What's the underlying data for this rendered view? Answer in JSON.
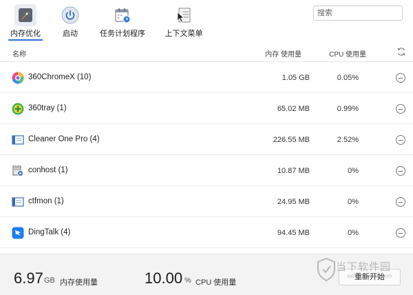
{
  "toolbar": {
    "tabs": [
      {
        "label": "内存优化",
        "icon": "rocket-icon",
        "active": true
      },
      {
        "label": "启动",
        "icon": "power-icon",
        "active": false
      },
      {
        "label": "任务计划程序",
        "icon": "calendar-clock-icon",
        "active": false
      },
      {
        "label": "上下文菜单",
        "icon": "cursor-menu-icon",
        "active": false
      }
    ],
    "search_placeholder": "搜索"
  },
  "table": {
    "headers": {
      "name": "名称",
      "memory": "内存 使用量",
      "cpu": "CPU 使用量"
    },
    "rows": [
      {
        "name": "360ChromeX (10)",
        "memory": "1.05 GB",
        "cpu": "0.05%",
        "icon": "chrome-360-icon"
      },
      {
        "name": "360tray (1)",
        "memory": "65.02 MB",
        "cpu": "0.99%",
        "icon": "360-tray-icon"
      },
      {
        "name": "Cleaner One Pro (4)",
        "memory": "226.55 MB",
        "cpu": "2.52%",
        "icon": "app-window-icon"
      },
      {
        "name": "conhost (1)",
        "memory": "10.87 MB",
        "cpu": "0%",
        "icon": "conhost-icon"
      },
      {
        "name": "ctfmon (1)",
        "memory": "24.95 MB",
        "cpu": "0%",
        "icon": "app-window-icon"
      },
      {
        "name": "DingTalk (4)",
        "memory": "94.45 MB",
        "cpu": "0%",
        "icon": "dingtalk-icon"
      }
    ]
  },
  "status": {
    "memory_value": "6.97",
    "memory_unit": "GB",
    "memory_caption": "内存使用量",
    "cpu_value": "10.00",
    "cpu_unit": "%",
    "cpu_caption": "CPU 使用量",
    "restart_label": "重新开始"
  },
  "watermark": {
    "text": "当下软件园",
    "sub": "www.downxia.com"
  },
  "colors": {
    "accent": "#2d6fd6",
    "active_tab_bg": "#e9edf3",
    "status_bg": "#f3f3f3"
  }
}
